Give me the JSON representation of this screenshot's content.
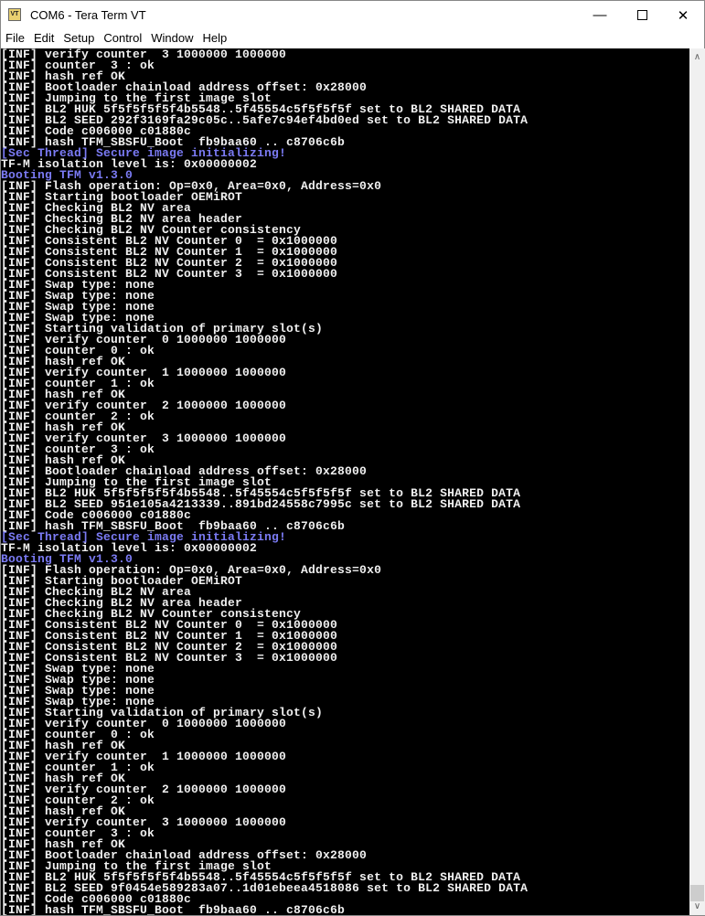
{
  "window": {
    "title": "COM6 - Tera Term VT",
    "icon_label": "VT"
  },
  "menu": [
    "File",
    "Edit",
    "Setup",
    "Control",
    "Window",
    "Help"
  ],
  "colors": {
    "info": "#f0f0f0",
    "highlight": "#7b7bf5",
    "background": "#000000"
  },
  "scrollbar": {
    "position": 0.97
  },
  "lines": [
    {
      "t": "[INF] verify counter  3 1000000 1000000"
    },
    {
      "t": "[INF] counter  3 : ok"
    },
    {
      "t": "[INF] hash ref OK"
    },
    {
      "t": "[INF] Bootloader chainload address offset: 0x28000"
    },
    {
      "t": "[INF] Jumping to the first image slot"
    },
    {
      "t": "[INF] BL2 HUK 5f5f5f5f5f4b5548..5f45554c5f5f5f5f set to BL2 SHARED DATA"
    },
    {
      "t": "[INF] BL2 SEED 292f3169fa29c05c..5afe7c94ef4bd0ed set to BL2 SHARED DATA"
    },
    {
      "t": "[INF] Code c006000 c01880c"
    },
    {
      "t": "[INF] hash TFM_SBSFU_Boot  fb9baa60 .. c8706c6b"
    },
    {
      "t": "[Sec Thread] Secure image initializing!",
      "s": "blue"
    },
    {
      "t": "TF-M isolation level is: 0x00000002"
    },
    {
      "t": "Booting TFM v1.3.0",
      "s": "blue"
    },
    {
      "t": "[INF] Flash operation: Op=0x0, Area=0x0, Address=0x0"
    },
    {
      "t": "[INF] Starting bootloader OEMiROT"
    },
    {
      "t": "[INF] Checking BL2 NV area"
    },
    {
      "t": "[INF] Checking BL2 NV area header"
    },
    {
      "t": "[INF] Checking BL2 NV Counter consistency"
    },
    {
      "t": "[INF] Consistent BL2 NV Counter 0  = 0x1000000"
    },
    {
      "t": "[INF] Consistent BL2 NV Counter 1  = 0x1000000"
    },
    {
      "t": "[INF] Consistent BL2 NV Counter 2  = 0x1000000"
    },
    {
      "t": "[INF] Consistent BL2 NV Counter 3  = 0x1000000"
    },
    {
      "t": "[INF] Swap type: none"
    },
    {
      "t": "[INF] Swap type: none"
    },
    {
      "t": "[INF] Swap type: none"
    },
    {
      "t": "[INF] Swap type: none"
    },
    {
      "t": "[INF] Starting validation of primary slot(s)"
    },
    {
      "t": "[INF] verify counter  0 1000000 1000000"
    },
    {
      "t": "[INF] counter  0 : ok"
    },
    {
      "t": "[INF] hash ref OK"
    },
    {
      "t": "[INF] verify counter  1 1000000 1000000"
    },
    {
      "t": "[INF] counter  1 : ok"
    },
    {
      "t": "[INF] hash ref OK"
    },
    {
      "t": "[INF] verify counter  2 1000000 1000000"
    },
    {
      "t": "[INF] counter  2 : ok"
    },
    {
      "t": "[INF] hash ref OK"
    },
    {
      "t": "[INF] verify counter  3 1000000 1000000"
    },
    {
      "t": "[INF] counter  3 : ok"
    },
    {
      "t": "[INF] hash ref OK"
    },
    {
      "t": "[INF] Bootloader chainload address offset: 0x28000"
    },
    {
      "t": "[INF] Jumping to the first image slot"
    },
    {
      "t": "[INF] BL2 HUK 5f5f5f5f5f4b5548..5f45554c5f5f5f5f set to BL2 SHARED DATA"
    },
    {
      "t": "[INF] BL2 SEED 951e105a4213339..891bd24558c7995c set to BL2 SHARED DATA"
    },
    {
      "t": "[INF] Code c006000 c01880c"
    },
    {
      "t": "[INF] hash TFM_SBSFU_Boot  fb9baa60 .. c8706c6b"
    },
    {
      "t": "[Sec Thread] Secure image initializing!",
      "s": "blue"
    },
    {
      "t": "TF-M isolation level is: 0x00000002"
    },
    {
      "t": "Booting TFM v1.3.0",
      "s": "blue"
    },
    {
      "t": "[INF] Flash operation: Op=0x0, Area=0x0, Address=0x0"
    },
    {
      "t": "[INF] Starting bootloader OEMiROT"
    },
    {
      "t": "[INF] Checking BL2 NV area"
    },
    {
      "t": "[INF] Checking BL2 NV area header"
    },
    {
      "t": "[INF] Checking BL2 NV Counter consistency"
    },
    {
      "t": "[INF] Consistent BL2 NV Counter 0  = 0x1000000"
    },
    {
      "t": "[INF] Consistent BL2 NV Counter 1  = 0x1000000"
    },
    {
      "t": "[INF] Consistent BL2 NV Counter 2  = 0x1000000"
    },
    {
      "t": "[INF] Consistent BL2 NV Counter 3  = 0x1000000"
    },
    {
      "t": "[INF] Swap type: none"
    },
    {
      "t": "[INF] Swap type: none"
    },
    {
      "t": "[INF] Swap type: none"
    },
    {
      "t": "[INF] Swap type: none"
    },
    {
      "t": "[INF] Starting validation of primary slot(s)"
    },
    {
      "t": "[INF] verify counter  0 1000000 1000000"
    },
    {
      "t": "[INF] counter  0 : ok"
    },
    {
      "t": "[INF] hash ref OK"
    },
    {
      "t": "[INF] verify counter  1 1000000 1000000"
    },
    {
      "t": "[INF] counter  1 : ok"
    },
    {
      "t": "[INF] hash ref OK"
    },
    {
      "t": "[INF] verify counter  2 1000000 1000000"
    },
    {
      "t": "[INF] counter  2 : ok"
    },
    {
      "t": "[INF] hash ref OK"
    },
    {
      "t": "[INF] verify counter  3 1000000 1000000"
    },
    {
      "t": "[INF] counter  3 : ok"
    },
    {
      "t": "[INF] hash ref OK"
    },
    {
      "t": "[INF] Bootloader chainload address offset: 0x28000"
    },
    {
      "t": "[INF] Jumping to the first image slot"
    },
    {
      "t": "[INF] BL2 HUK 5f5f5f5f5f4b5548..5f45554c5f5f5f5f set to BL2 SHARED DATA"
    },
    {
      "t": "[INF] BL2 SEED 9f0454e589283a07..1d01ebeea4518086 set to BL2 SHARED DATA"
    },
    {
      "t": "[INF] Code c006000 c01880c"
    },
    {
      "t": "[INF] hash TFM_SBSFU_Boot  fb9baa60 .. c8706c6b"
    }
  ]
}
